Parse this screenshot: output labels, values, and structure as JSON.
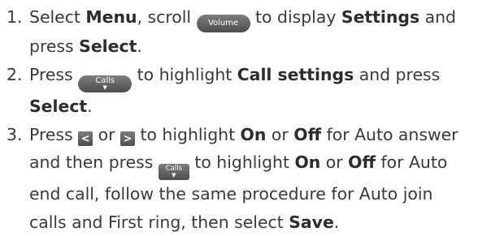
{
  "steps": [
    {
      "number": "1.",
      "part1": "Select ",
      "b1": "Menu",
      "part2": ", scroll ",
      "key_label": "Volume",
      "part3": " to display ",
      "b2": "Settings",
      "part4": " and press ",
      "b3": "Select",
      "part5": "."
    },
    {
      "number": "2.",
      "part1": "Press ",
      "key_label": "Calls",
      "part2": " to highlight ",
      "b1": "Call settings",
      "part3": " and press ",
      "b2": "Select",
      "part4": "."
    },
    {
      "number": "3.",
      "part1": "Press ",
      "left_key": "<",
      "part2": " or ",
      "right_key": ">",
      "part3": " to highlight ",
      "b1": "On",
      "part4": " or ",
      "b2": "Off",
      "part5": " for Auto answer and then press ",
      "key_label": "Calls",
      "part6": " to highlight ",
      "b3": "On",
      "part7": " or ",
      "b4": "Off",
      "part8": " for Auto end call, follow the same procedure for Auto join calls and First ring, then select ",
      "b5": "Save",
      "part9": "."
    }
  ]
}
